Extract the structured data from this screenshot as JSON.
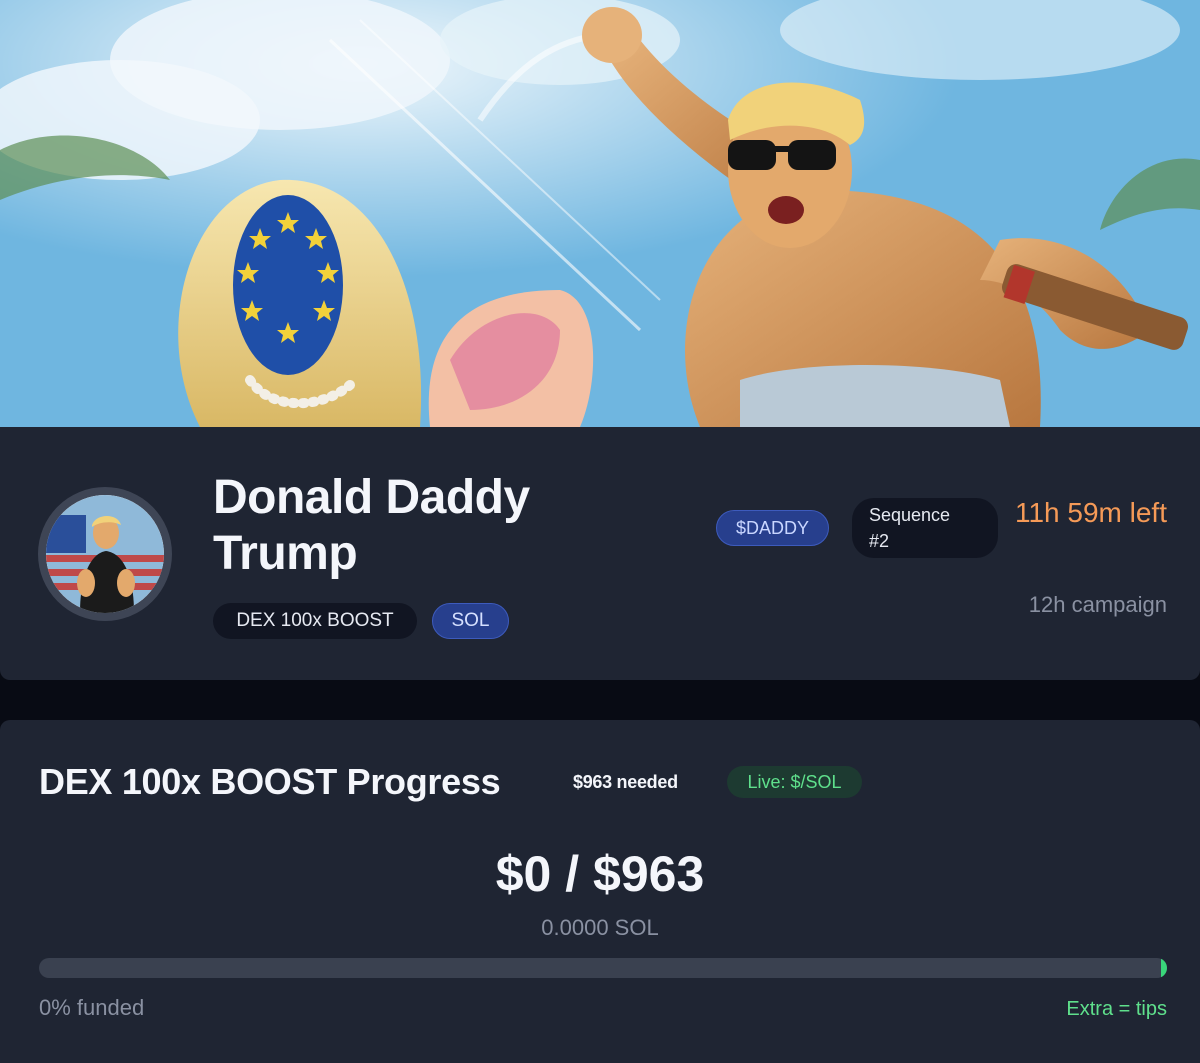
{
  "header": {
    "title": "Donald Daddy Trump",
    "tags": [
      "DEX 100x BOOST",
      "SOL"
    ],
    "ticker": "$DADDY",
    "sequence_label": "Sequence",
    "sequence_number": "#2",
    "time_left": "11h 59m left",
    "campaign_length": "12h campaign"
  },
  "progress": {
    "title": "DEX 100x BOOST Progress",
    "needed": "$963 needed",
    "live_label": "Live: $/SOL",
    "amount": "$0 / $963",
    "sol_amount": "0.0000 SOL",
    "funded_fraction": 0,
    "funded_label": "0% funded",
    "tips_label": "Extra = tips"
  },
  "colors": {
    "card_bg": "#1f2533",
    "accent_orange": "#f59a57",
    "accent_green": "#5fe08c",
    "accent_blue": "#273f8d"
  },
  "icons": {
    "banner": "campaign-banner-illustration",
    "avatar": "token-avatar-image"
  }
}
